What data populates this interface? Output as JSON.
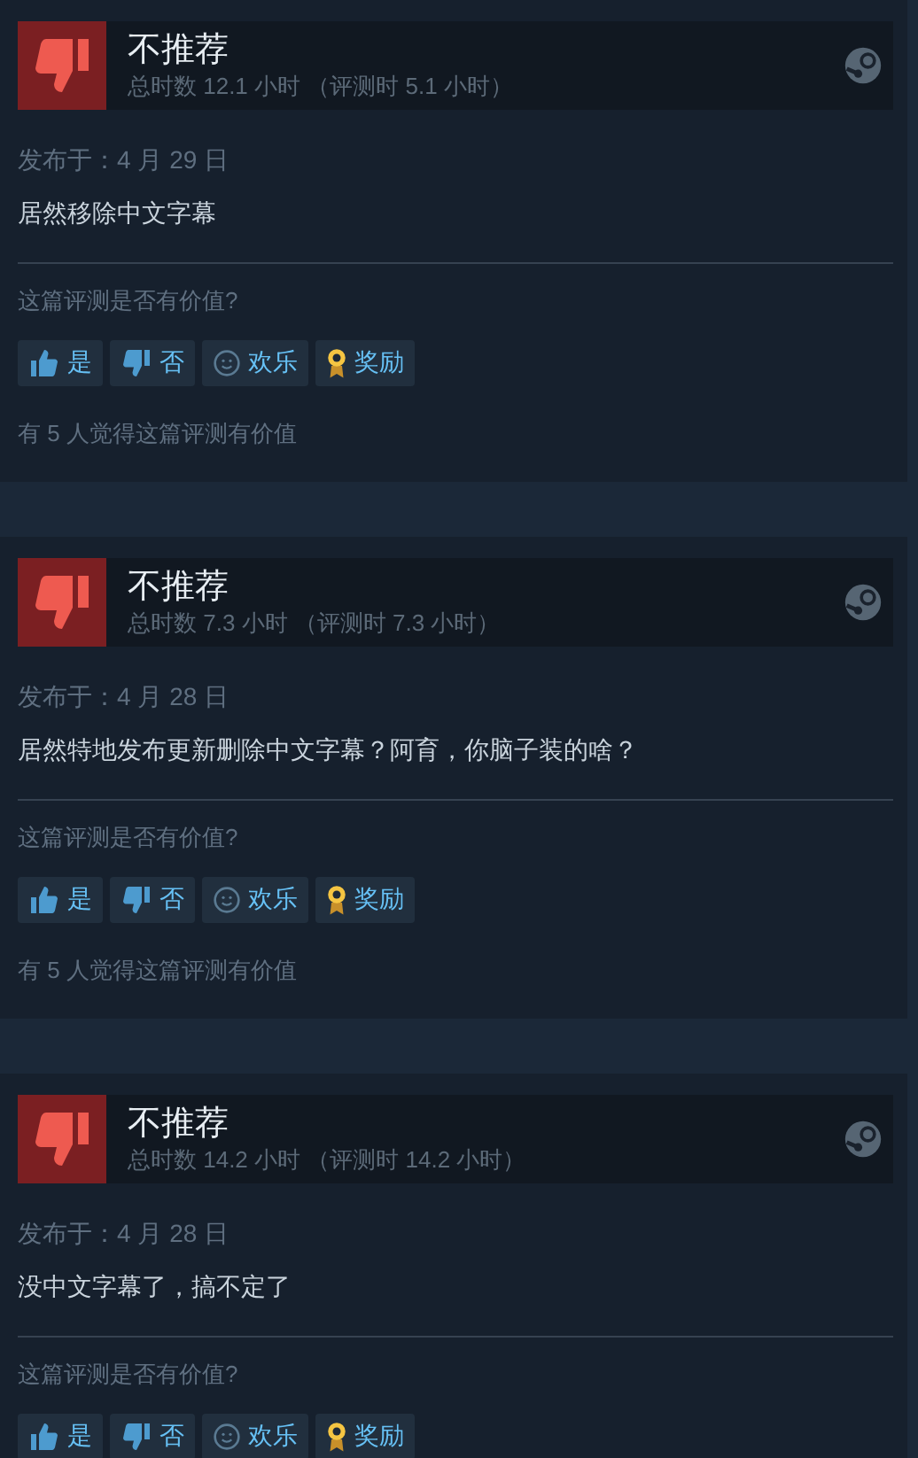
{
  "reviews": [
    {
      "verdict": "不推荐",
      "playtime": "总时数 12.1 小时 （评测时 5.1 小时）",
      "posted": "发布于：4 月 29 日",
      "text": "居然移除中文字幕",
      "question": "这篇评测是否有价值?",
      "buttons": [
        {
          "kind": "yes",
          "label": "是"
        },
        {
          "kind": "no",
          "label": "否"
        },
        {
          "kind": "funny",
          "label": "欢乐"
        },
        {
          "kind": "award",
          "label": "奖励"
        }
      ],
      "helpful": "有 5 人觉得这篇评测有价值"
    },
    {
      "verdict": "不推荐",
      "playtime": "总时数 7.3 小时 （评测时 7.3 小时）",
      "posted": "发布于：4 月 28 日",
      "text": "居然特地发布更新删除中文字幕？阿育，你脑子装的啥？",
      "question": "这篇评测是否有价值?",
      "buttons": [
        {
          "kind": "yes",
          "label": "是"
        },
        {
          "kind": "no",
          "label": "否"
        },
        {
          "kind": "funny",
          "label": "欢乐"
        },
        {
          "kind": "award",
          "label": "奖励"
        }
      ],
      "helpful": "有 5 人觉得这篇评测有价值"
    },
    {
      "verdict": "不推荐",
      "playtime": "总时数 14.2 小时 （评测时 14.2 小时）",
      "posted": "发布于：4 月 28 日",
      "text": "没中文字幕了，搞不定了",
      "question": "这篇评测是否有价值?",
      "buttons": [
        {
          "kind": "yes",
          "label": "是"
        },
        {
          "kind": "no",
          "label": "否"
        },
        {
          "kind": "funny",
          "label": "欢乐"
        },
        {
          "kind": "award",
          "label": "奖励"
        }
      ]
    }
  ]
}
